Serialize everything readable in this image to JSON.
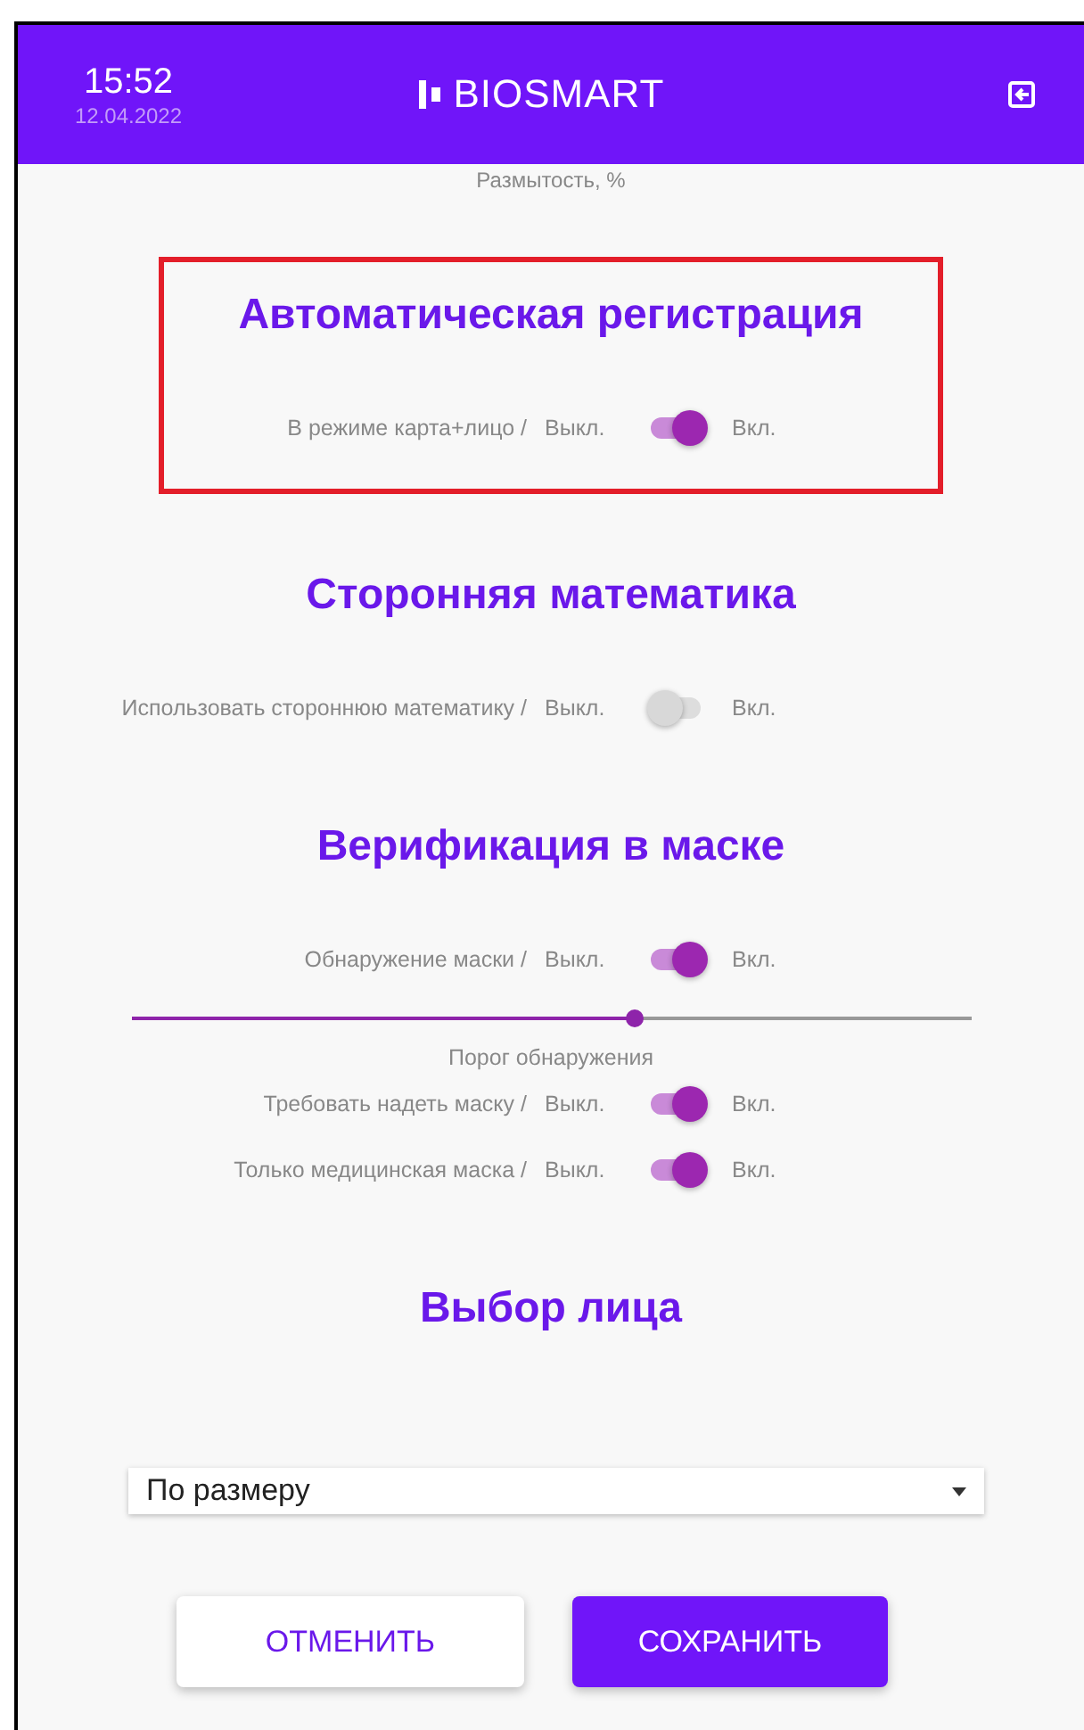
{
  "header": {
    "time": "15:52",
    "date": "12.04.2022",
    "logo": "BIOSMART"
  },
  "top_caption": "Размытость, %",
  "sections": [
    {
      "title": "Автоматическая регистрация",
      "highlighted": true,
      "items": [
        {
          "kind": "toggle",
          "label": "В режиме карта+лицо /",
          "off": "Выкл.",
          "on_label": "Вкл.",
          "on": true
        }
      ]
    },
    {
      "title": "Сторонняя математика",
      "highlighted": false,
      "items": [
        {
          "kind": "toggle",
          "label": "Использовать стороннюю математику /",
          "off": "Выкл.",
          "on_label": "Вкл.",
          "on": false
        }
      ]
    },
    {
      "title": "Верификация в маске",
      "highlighted": false,
      "items": [
        {
          "kind": "toggle",
          "label": "Обнаружение маски /",
          "off": "Выкл.",
          "on_label": "Вкл.",
          "on": true
        },
        {
          "kind": "slider",
          "level": 0.6
        },
        {
          "kind": "caption",
          "text": "Порог обнаружения"
        },
        {
          "kind": "toggle",
          "label": "Требовать надеть маску /",
          "off": "Выкл.",
          "on_label": "Вкл.",
          "on": true
        },
        {
          "kind": "toggle",
          "label": "Только медицинская маска /",
          "off": "Выкл.",
          "on_label": "Вкл.",
          "on": true
        }
      ]
    },
    {
      "title": "Выбор лица",
      "highlighted": false
    }
  ],
  "select": {
    "value": "По размеру"
  },
  "buttons": [
    {
      "kind": "secondary",
      "label": "ОТМЕНИТЬ"
    },
    {
      "kind": "primary",
      "label": "СОХРАНИТЬ"
    }
  ]
}
